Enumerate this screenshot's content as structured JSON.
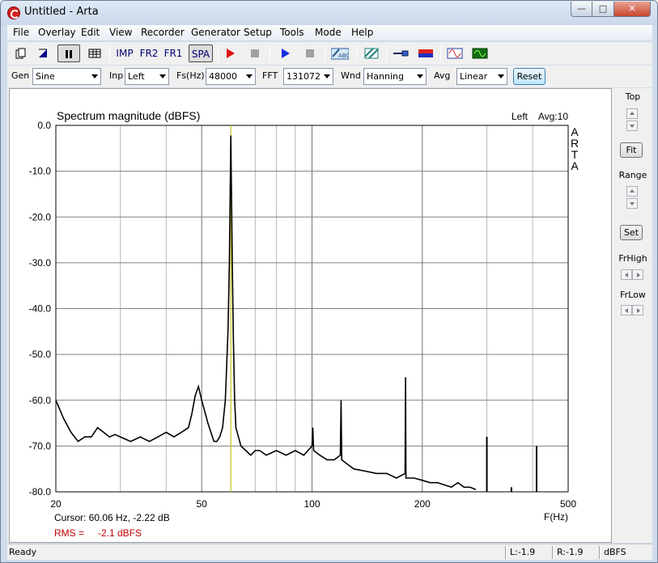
{
  "window": {
    "title": "Untitled - Arta"
  },
  "menu": [
    "File",
    "Overlay",
    "Edit",
    "View",
    "Recorder",
    "Generator",
    "Setup",
    "Tools",
    "Mode",
    "Help"
  ],
  "toolbar": {
    "imp": "IMP",
    "fr2": "FR2",
    "fr1": "FR1",
    "spa": "SPA"
  },
  "controls": {
    "gen_label": "Gen",
    "gen_value": "Sine",
    "inp_label": "Inp",
    "inp_value": "Left",
    "fs_label": "Fs(Hz)",
    "fs_value": "48000",
    "fft_label": "FFT",
    "fft_value": "131072",
    "wnd_label": "Wnd",
    "wnd_value": "Hanning",
    "avg_label": "Avg",
    "avg_value": "Linear",
    "reset": "Reset"
  },
  "side": {
    "top": "Top",
    "fit": "Fit",
    "range": "Range",
    "set": "Set",
    "frhigh": "FrHigh",
    "frlow": "FrLow"
  },
  "plot": {
    "title": "Spectrum magnitude (dBFS)",
    "channel": "Left",
    "avg": "Avg:10",
    "brand": [
      "A",
      "R",
      "T",
      "A"
    ],
    "cursor": "Cursor: 60.06 Hz, -2.22 dB",
    "rms_label": "RMS =",
    "rms_value": "-2.1 dBFS",
    "colors": {
      "trace": "#000000",
      "cursor": "#c8c800",
      "rms": "#c00000",
      "grid": "#808080"
    }
  },
  "status": {
    "ready": "Ready",
    "l": "L:-1.9",
    "r": "R:-1.9",
    "units": "dBFS"
  },
  "chart_data": {
    "type": "line",
    "title": "Spectrum magnitude (dBFS)",
    "xlabel": "F(Hz)",
    "ylabel": "",
    "xscale": "log",
    "xlim": [
      20,
      500
    ],
    "ylim": [
      -80,
      0
    ],
    "xticks": [
      20,
      50,
      100,
      200,
      500
    ],
    "yticks": [
      0,
      -10,
      -20,
      -30,
      -40,
      -50,
      -60,
      -70,
      -80
    ],
    "ytick_labels": [
      "0.0",
      "-10.0",
      "-20.0",
      "-30.0",
      "-40.0",
      "-50.0",
      "-60.0",
      "-70.0",
      "-80.0"
    ],
    "cursor_x": 60.06,
    "series": [
      {
        "x": [
          20,
          21,
          22,
          23,
          24,
          25,
          26,
          27,
          28,
          29,
          30,
          32,
          34,
          36,
          38,
          40,
          42,
          44,
          46,
          47,
          48,
          49,
          50,
          52,
          54,
          55,
          56,
          57,
          58,
          59,
          59.5,
          60.06,
          60.6,
          61,
          61.5,
          62,
          63,
          64,
          66,
          68,
          70,
          72,
          75,
          80,
          85,
          90,
          95,
          100,
          100.5,
          101,
          105,
          110,
          115,
          119.5,
          120,
          120.5,
          125,
          130,
          140,
          150,
          160,
          170,
          179.5,
          180,
          180.5,
          190,
          200,
          210,
          220,
          230,
          240,
          250,
          260,
          270,
          280
        ],
        "y": [
          -60,
          -64,
          -67,
          -69,
          -68,
          -68,
          -66,
          -67,
          -68,
          -67.5,
          -68,
          -69,
          -68,
          -69,
          -68,
          -67,
          -68,
          -67,
          -66,
          -63,
          -59,
          -57,
          -60,
          -65,
          -69,
          -69,
          -68,
          -66,
          -60,
          -45,
          -30,
          -2.2,
          -30,
          -46,
          -60,
          -66,
          -68,
          -70,
          -71,
          -72,
          -71,
          -71,
          -72,
          -71,
          -72,
          -71,
          -72,
          -70,
          -66,
          -71,
          -72,
          -73,
          -73,
          -72,
          -60,
          -73,
          -74,
          -75,
          -75.5,
          -76,
          -76,
          -77,
          -76,
          -55,
          -77,
          -77,
          -77.5,
          -78,
          -78,
          -78.5,
          -79,
          -78,
          -79,
          -79,
          -79.5
        ]
      },
      {
        "x": [
          300,
          350,
          410
        ],
        "y": [
          -68,
          -79,
          -70
        ]
      }
    ]
  }
}
